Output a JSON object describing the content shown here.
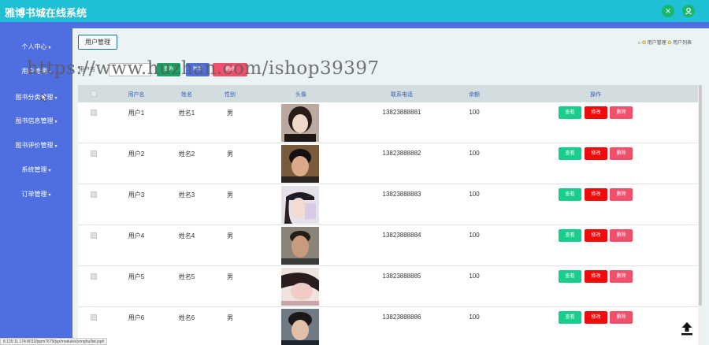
{
  "app": {
    "title": "雅博书城在线系统"
  },
  "header": {
    "icons": [
      "expand-icon",
      "user-icon"
    ]
  },
  "sidebar": {
    "items": [
      {
        "label": "个人中心"
      },
      {
        "label": "用户管理"
      },
      {
        "label": "图书分类管理"
      },
      {
        "label": "图书信息管理"
      },
      {
        "label": "图书评价管理"
      },
      {
        "label": "系统管理"
      },
      {
        "label": "订单管理"
      }
    ]
  },
  "page": {
    "tag_label": "用户管理",
    "breadcrumb": {
      "home": "用户管理",
      "current": "用户列表"
    }
  },
  "search": {
    "label": "用户名",
    "value": "",
    "buttons": [
      {
        "label": "查询",
        "color": "#19a463"
      },
      {
        "label": "新增",
        "color": "#4f6fe0"
      },
      {
        "label": "删除",
        "color": "#f0506b"
      }
    ]
  },
  "watermark": "https://www.huzhan.com/ishop39397",
  "table": {
    "columns": [
      "用户名",
      "姓名",
      "性别",
      "头像",
      "联系电话",
      "余额",
      "操作"
    ],
    "rows": [
      {
        "username": "用户1",
        "name": "姓名1",
        "gender": "男",
        "phone": "13823888881",
        "balance": "100"
      },
      {
        "username": "用户2",
        "name": "姓名2",
        "gender": "男",
        "phone": "13823888882",
        "balance": "100"
      },
      {
        "username": "用户3",
        "name": "姓名3",
        "gender": "男",
        "phone": "13823888883",
        "balance": "100"
      },
      {
        "username": "用户4",
        "name": "姓名4",
        "gender": "男",
        "phone": "13823888884",
        "balance": "100"
      },
      {
        "username": "用户5",
        "name": "姓名5",
        "gender": "男",
        "phone": "13823888885",
        "balance": "100"
      },
      {
        "username": "用户6",
        "name": "姓名6",
        "gender": "男",
        "phone": "13823888886",
        "balance": "100"
      }
    ],
    "actions": {
      "view": "查看",
      "edit": "修改",
      "delete": "删除"
    }
  },
  "status_url": "8.129.11.174:8013/jspm7679/jsp/modules/yonghu/list.jsp#",
  "colors": {
    "topbar": "#1fc0d6",
    "sidebar": "#4f6fe0",
    "view": "#17ce8c",
    "edit": "#f00c0c",
    "delete": "#f0506b"
  }
}
